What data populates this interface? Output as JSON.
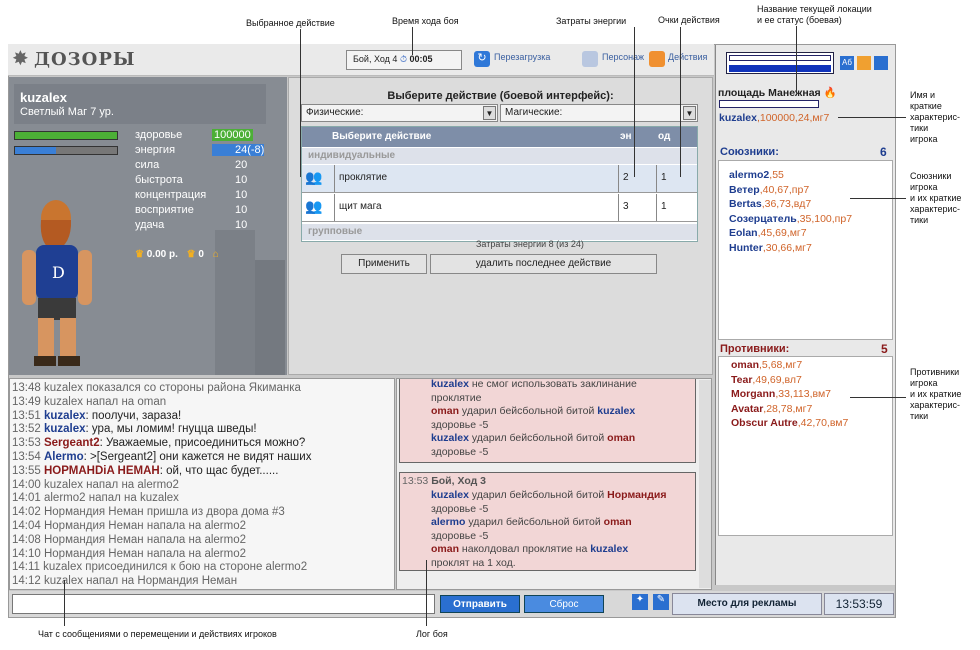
{
  "callouts": {
    "selected_action": "Выбранное действие",
    "turn_time": "Время хода боя",
    "energy_cost": "Затраты энергии",
    "action_points": "Очки действия",
    "location_name": "Название текущей локации\nи ее статус (боевая)",
    "player_name": "Имя и\nкраткие\nхарактерис-\nтики\nигрока",
    "allies": "Союзники\nигрока\nи их краткие\nхарактерис-\nтики",
    "enemies": "Противники\nигрока\nи их краткие\nхарактерис-\nтики",
    "chat": "Чат с сообщениями о перемещении и действиях игроков",
    "battle_log": "Лог боя"
  },
  "header": {
    "logo": "ДОЗОРЫ",
    "turn_label": "Бой, Ход 4",
    "turn_timer": "00:05",
    "reload": "Перезагрузка",
    "character": "Персонаж",
    "actions": "Действия"
  },
  "player": {
    "name": "kuzalex",
    "desc": "Светлый  Маг 7 ур.",
    "stats": [
      {
        "label": "здоровье",
        "value": "100000"
      },
      {
        "label": "энергия",
        "value": "24(-8)"
      },
      {
        "label": "сила",
        "value": "20"
      },
      {
        "label": "быстрота",
        "value": "10"
      },
      {
        "label": "концентрация",
        "value": "10"
      },
      {
        "label": "восприятие",
        "value": "10"
      },
      {
        "label": "удача",
        "value": "10"
      }
    ],
    "money": "0.00 р.",
    "items": "0",
    "health_fill": 1.0,
    "energy_fill": 0.4
  },
  "action_panel": {
    "title": "Выберите действие (боевой интерфейс):",
    "physical": "Физические:",
    "magic": "Магические:",
    "col_action": "Выберите действие",
    "col_en": "эн",
    "col_od": "од",
    "group_individual": "индивидуальные",
    "group_group": "групповые",
    "rows": [
      {
        "name": "проклятие",
        "en": "2",
        "od": "1"
      },
      {
        "name": "щит мага",
        "en": "3",
        "od": "1"
      }
    ],
    "energy_note": "Затраты энергии 8 (из 24)",
    "apply": "Применить",
    "delete_last": "удалить последнее действие"
  },
  "chat": [
    {
      "time": "13:48",
      "text": "kuzalex показался со стороны района Якиманка",
      "style": "gray"
    },
    {
      "time": "13:49",
      "text": "kuzalex напал на oman",
      "style": "gray"
    },
    {
      "time": "13:51",
      "nick": "kuzalex",
      "text": ": поолучи, зараза!",
      "nickclass": "blue"
    },
    {
      "time": "13:52",
      "nick": "kuzalex",
      "text": ": ура, мы ломим! гнуцца шведы!",
      "nickclass": "blue"
    },
    {
      "time": "13:53",
      "nick": "Sergeant2",
      "text": ": Уважаемые, присоединиться можно?",
      "nickclass": "maroon"
    },
    {
      "time": "13:54",
      "nick": "Alermo",
      "text": ": >[Sergeant2] они кажется не видят наших",
      "nickclass": "blue"
    },
    {
      "time": "13:55",
      "nick": "НОРМАНDiA НЕМАН",
      "text": ": ой, что щас будет......",
      "nickclass": "maroon"
    },
    {
      "time": "14:00",
      "text": "kuzalex напал на alermo2",
      "style": "gray"
    },
    {
      "time": "14:01",
      "text": "alermo2 напал на kuzalex",
      "style": "gray"
    },
    {
      "time": "14:02",
      "text": "Нормандия Неман пришла из двора дома #3",
      "style": "gray"
    },
    {
      "time": "14:04",
      "text": "Нормандия Неман напала на alermo2",
      "style": "gray"
    },
    {
      "time": "14:08",
      "text": "Нормандия Неман напала на alermo2",
      "style": "gray"
    },
    {
      "time": "14:10",
      "text": "Нормандия Неман напала на alermo2",
      "style": "gray"
    },
    {
      "time": "14:11",
      "text": "kuzalex присоединился к бою на стороне alermo2",
      "style": "gray"
    },
    {
      "time": "14:12",
      "text": "kuzalex напал на Нормандия Неман",
      "style": "gray"
    }
  ],
  "battlelog": {
    "block1": [
      [
        "kuzalex",
        " не смог использовать заклинание",
        "",
        ""
      ],
      [
        "",
        "проклятие",
        "",
        ""
      ],
      [
        "oman",
        " ударил бейсбольной битой ",
        "kuzalex",
        ""
      ],
      [
        "",
        "здоровье -5",
        "",
        ""
      ],
      [
        "kuzalex",
        " ударил бейсбольной битой ",
        "oman",
        ""
      ],
      [
        "",
        "здоровье -5",
        "",
        ""
      ]
    ],
    "block2_head_time": "13:53",
    "block2_head": "Бой, Ход 3",
    "block2": [
      [
        "kuzalex",
        " ударил бейсбольной битой ",
        "Нормандия",
        ""
      ],
      [
        "",
        "здоровье -5",
        "",
        ""
      ],
      [
        "alermo",
        " ударил бейсбольной битой ",
        "oman",
        ""
      ],
      [
        "",
        "здоровье -5",
        "",
        ""
      ],
      [
        "oman",
        " наколдовал проклятие на ",
        "kuzalex",
        ""
      ],
      [
        "",
        "проклят на 1 ход.",
        "",
        ""
      ]
    ]
  },
  "right": {
    "location": "площадь Манежная",
    "self_name": "kuzalex",
    "self_stats": "100000,24,мг7",
    "allies_title": "Союзники:",
    "allies_count": "6",
    "allies": [
      {
        "name": "alermo2",
        "stats": "55"
      },
      {
        "name": "Ветер",
        "stats": "40,67,пр7"
      },
      {
        "name": "Bertas",
        "stats": "36,73,вд7"
      },
      {
        "name": "Созерцатель",
        "stats": "35,100,пр7"
      },
      {
        "name": "Eolan",
        "stats": "45,69,мг7"
      },
      {
        "name": "Hunter",
        "stats": "30,66,мг7"
      }
    ],
    "enemies_title": "Противники:",
    "enemies_count": "5",
    "enemies": [
      {
        "name": "oman",
        "stats": "5,68,мг7"
      },
      {
        "name": "Tear",
        "stats": "49,69,вл7"
      },
      {
        "name": "Morgann",
        "stats": "33,113,вм7"
      },
      {
        "name": "Avatar",
        "stats": "28,78,мг7"
      },
      {
        "name": "Obscur Autre",
        "stats": "42,70,вм7"
      }
    ]
  },
  "bottom": {
    "send": "Отправить",
    "reset": "Сброс",
    "ad": "Место для рекламы",
    "clock": "13:53:59",
    "input_value": ""
  }
}
